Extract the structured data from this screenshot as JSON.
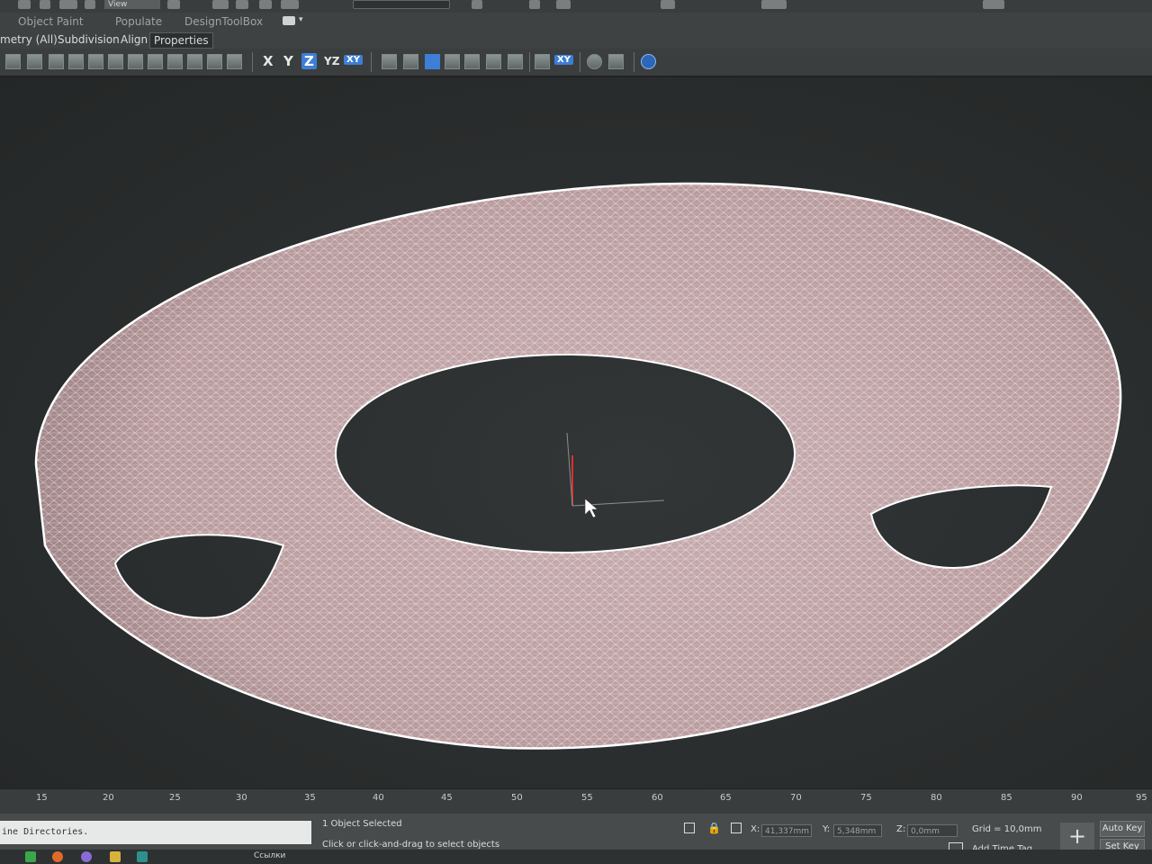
{
  "title_bar": {
    "view_dropdown": "View"
  },
  "tab_row": {
    "tabs": [
      "Object Paint",
      "Populate",
      "DesignToolBox"
    ]
  },
  "ribbon": {
    "tabs": [
      "metry (All)",
      "Subdivision",
      "Align",
      "Properties"
    ],
    "active": "Properties"
  },
  "toolbar": {
    "axis_buttons": [
      "X",
      "Y",
      "Z",
      "YZ",
      "XY"
    ],
    "active_axis": "Z",
    "extra_axis": "XY"
  },
  "viewport": {
    "object": "wireframe-torus-mesh",
    "surface_color": "#b8999c",
    "wire_color": "#ffffff"
  },
  "timeline": {
    "ticks": [
      "15",
      "20",
      "25",
      "30",
      "35",
      "40",
      "45",
      "50",
      "55",
      "60",
      "65",
      "70",
      "75",
      "80",
      "85",
      "90",
      "95"
    ]
  },
  "status": {
    "listener_text": "ine Directories.",
    "selection": "1 Object Selected",
    "prompt": "Click or click-and-drag to select objects",
    "x_label": "X:",
    "x_value": "41,337mm",
    "y_label": "Y:",
    "y_value": "5,348mm",
    "z_label": "Z:",
    "z_value": "0,0mm",
    "grid": "Grid = 10,0mm",
    "add_time_tag": "Add Time Tag",
    "auto_key": "Auto Key",
    "set_key": "Set Key"
  },
  "taskbar": {
    "item_label": "Ссылки"
  }
}
